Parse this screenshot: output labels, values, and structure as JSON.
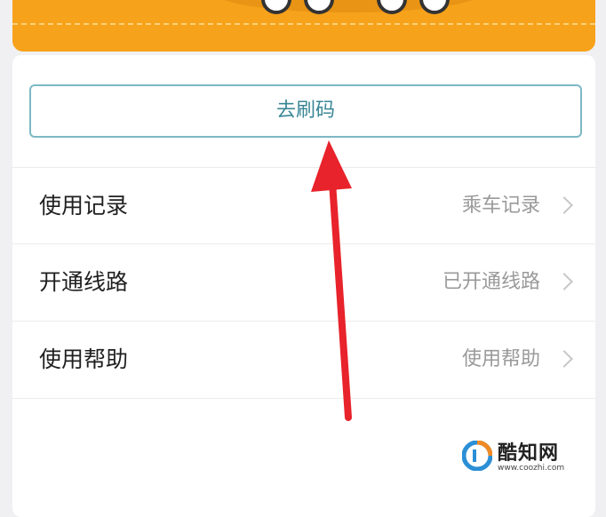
{
  "main": {
    "scan_button": "去刷码",
    "rows": [
      {
        "label": "使用记录",
        "value": "乘车记录"
      },
      {
        "label": "开通线路",
        "value": "已开通线路"
      },
      {
        "label": "使用帮助",
        "value": "使用帮助"
      }
    ]
  },
  "watermark": {
    "title": "酷知网",
    "url": "www.coozhi.com"
  },
  "colors": {
    "banner": "#f7a21b",
    "button_border": "#7db8c4",
    "button_text": "#3a8796",
    "arrow": "#e8232b"
  },
  "icons": [
    "chevron-right-icon",
    "arrow-annotation-icon",
    "coozhi-logo-icon"
  ]
}
